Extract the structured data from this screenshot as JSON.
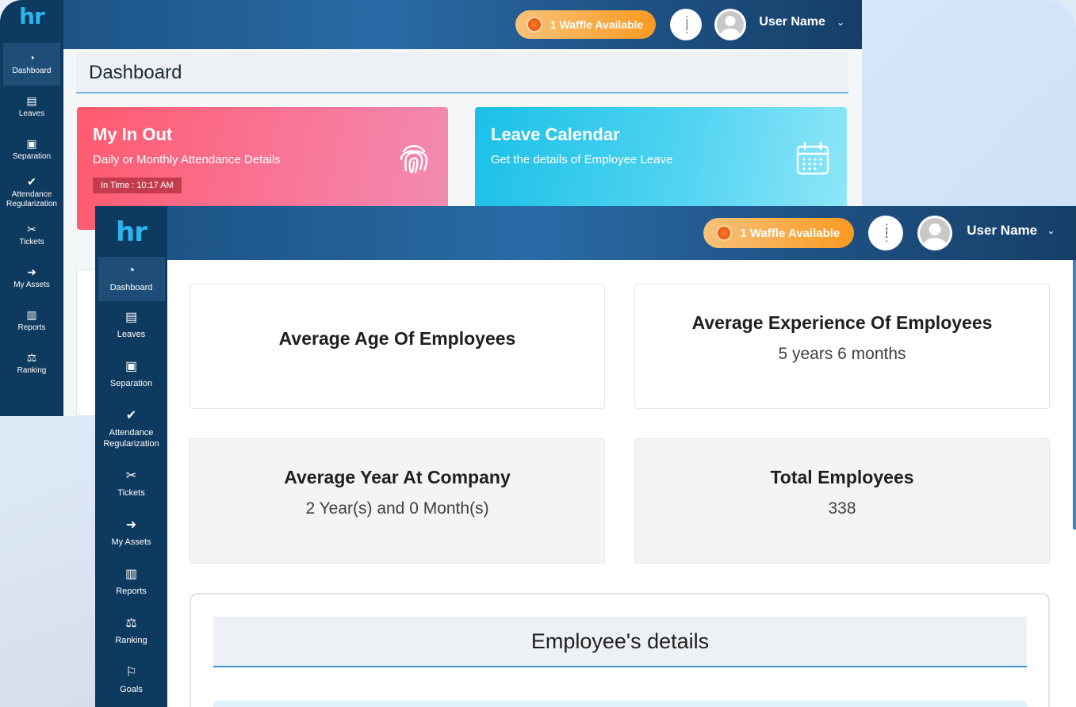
{
  "app": {
    "logo": "hr"
  },
  "sidebar": {
    "items": [
      {
        "label": "Dashboard",
        "icon": "◔",
        "active": true
      },
      {
        "label": "Leaves",
        "icon": "▤"
      },
      {
        "label": "Separation",
        "icon": "▣"
      },
      {
        "label": "Attendance Regularization",
        "icon": "✔"
      },
      {
        "label": "Tickets",
        "icon": "✂"
      },
      {
        "label": "My Assets",
        "icon": "➜"
      },
      {
        "label": "Reports",
        "icon": "▥"
      },
      {
        "label": "Ranking",
        "icon": "⚖"
      },
      {
        "label": "Goals",
        "icon": "⚐"
      }
    ]
  },
  "header": {
    "waffle_label": "1 Waffle Available",
    "grid_icon": "⋮⋮⋮",
    "user_name": "User Name",
    "chevron": "⌄"
  },
  "back": {
    "page_title": "Dashboard",
    "in_out": {
      "title": "My In Out",
      "subtitle": "Daily or Monthly Attendance Details",
      "in_time": "In Time : 10:17 AM"
    },
    "leave_calendar": {
      "title": "Leave Calendar",
      "subtitle": "Get the details of Employee Leave"
    }
  },
  "stats": {
    "avg_age": {
      "title": "Average Age Of Employees"
    },
    "avg_experience": {
      "title": "Average Experience Of Employees",
      "value": "5 years 6 months"
    },
    "avg_year_company": {
      "title": "Average Year At Company",
      "value": "2 Year(s) and 0 Month(s)"
    },
    "total_employees": {
      "title": "Total Employees",
      "value": "338"
    }
  },
  "employee_details": {
    "title": "Employee's details"
  },
  "colors": {
    "sidebar": "#0f3a5f",
    "accent": "#2bb6f0",
    "waffle": "#f99a20",
    "in_out_card": "#ff5a6e",
    "leave_card": "#1bc0e7"
  }
}
